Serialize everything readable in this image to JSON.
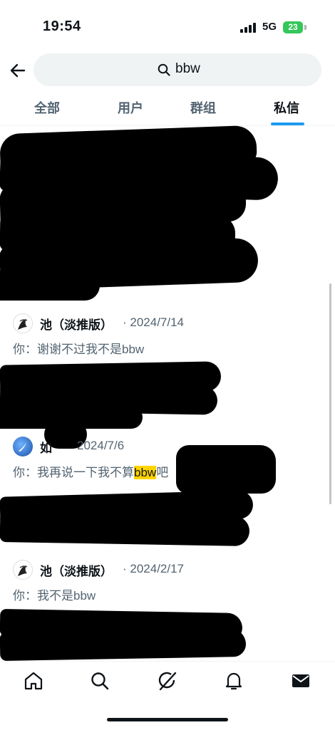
{
  "status_bar": {
    "time": "19:54",
    "network": "5G",
    "battery": "23"
  },
  "search": {
    "query": "bbw"
  },
  "tabs": [
    {
      "label": "全部",
      "active": false
    },
    {
      "label": "用户",
      "active": false
    },
    {
      "label": "群组",
      "active": false
    },
    {
      "label": "私信",
      "active": true
    }
  ],
  "results": [
    {
      "name": "池（淡推版）",
      "date": "· 2024/7/14",
      "prefix": "你：",
      "message": "谢谢不过我不是bbw"
    },
    {
      "name": "如",
      "date": "2024/7/6",
      "prefix": "你：",
      "message_before": "我再说一下我不算",
      "highlight": "bbw",
      "message_after": "吧"
    },
    {
      "name": "池（淡推版）",
      "date": "· 2024/2/17",
      "prefix": "你：",
      "message": "我不是bbw"
    }
  ],
  "colors": {
    "accent": "#1d9bf0",
    "highlight": "#ffd400",
    "secondary_text": "#536471"
  },
  "icons": [
    "back-arrow-icon",
    "search-icon",
    "home-icon",
    "explore-icon",
    "grok-icon",
    "notifications-icon",
    "messages-icon"
  ]
}
